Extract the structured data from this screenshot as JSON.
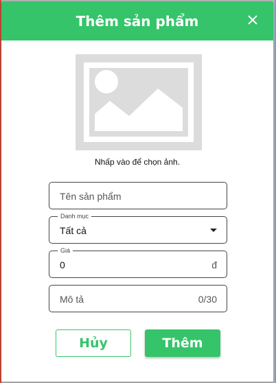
{
  "dialog": {
    "title": "Thêm sản phẩm",
    "close_icon": "close-icon"
  },
  "image_picker": {
    "icon": "image-placeholder-icon",
    "hint": "Nhấp vào để chọn ảnh."
  },
  "form": {
    "name": {
      "placeholder": "Tên sản phẩm",
      "value": ""
    },
    "category": {
      "label": "Danh mục",
      "value": "Tất cả"
    },
    "price": {
      "label": "Giá",
      "value": "0",
      "suffix": "đ"
    },
    "description": {
      "placeholder": "Mô tả",
      "value": "",
      "counter": "0/30"
    }
  },
  "buttons": {
    "cancel_label": "Hủy",
    "add_label": "Thêm"
  },
  "colors": {
    "accent": "#35c46a",
    "placeholder_image": "#dcdcdc"
  }
}
